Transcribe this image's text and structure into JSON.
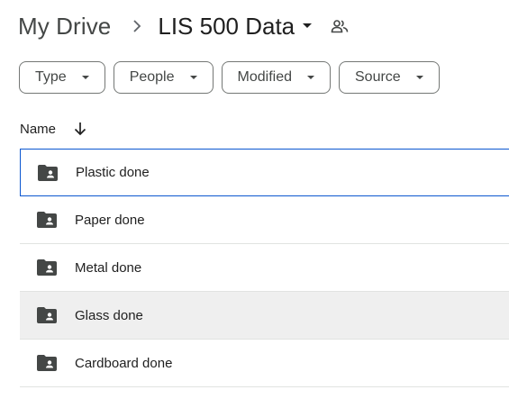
{
  "breadcrumb": {
    "root": "My Drive",
    "current": "LIS 500 Data",
    "separator_icon": "chevron-right-icon",
    "caret_icon": "caret-down-icon",
    "shared_icon": "people-icon"
  },
  "filters": [
    {
      "label": "Type"
    },
    {
      "label": "People"
    },
    {
      "label": "Modified"
    },
    {
      "label": "Source"
    }
  ],
  "list": {
    "column_name": "Name",
    "sort_icon": "arrow-down-icon",
    "rows": [
      {
        "label": "Plastic done",
        "icon": "shared-folder-icon",
        "state": "selected"
      },
      {
        "label": "Paper done",
        "icon": "shared-folder-icon",
        "state": "normal"
      },
      {
        "label": "Metal done",
        "icon": "shared-folder-icon",
        "state": "normal"
      },
      {
        "label": "Glass done",
        "icon": "shared-folder-icon",
        "state": "hover"
      },
      {
        "label": "Cardboard done",
        "icon": "shared-folder-icon",
        "state": "normal"
      }
    ]
  },
  "colors": {
    "selection_border": "#0b57d0",
    "hover_background": "#efefef",
    "icon": "#444746",
    "divider": "#e1e3e1"
  }
}
